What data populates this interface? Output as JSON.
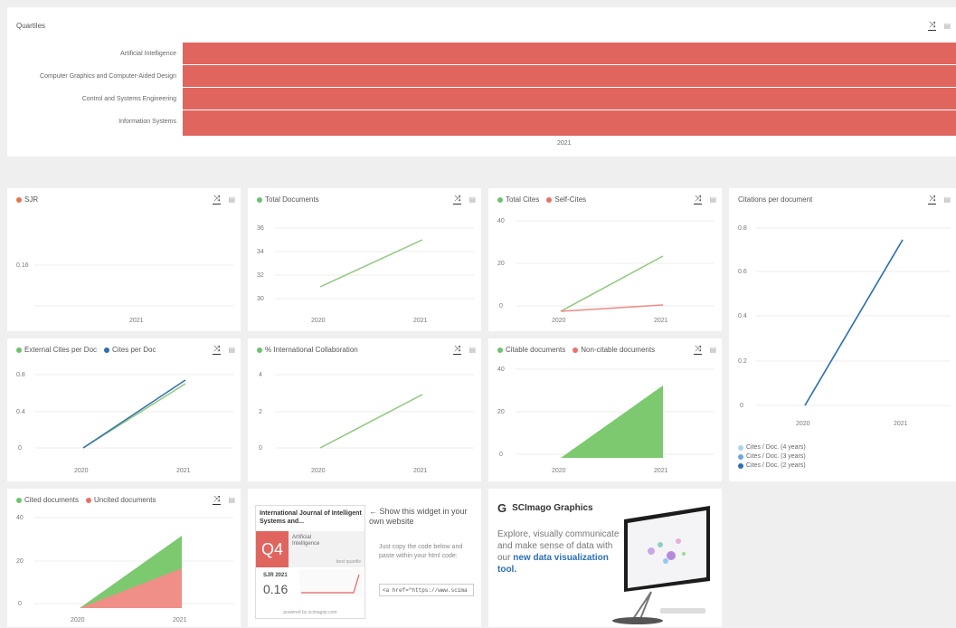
{
  "quartiles": {
    "title": "Quartiles",
    "categories": [
      "Artificial Intelligence",
      "Computer Graphics and Computer-Aided Design",
      "Control and Systems Engineering",
      "Information Systems"
    ],
    "year": "2021",
    "color": "#e0655f"
  },
  "sjr": {
    "legend": [
      "SJR"
    ],
    "yticks": [
      "0.16"
    ],
    "xticks": [
      "2021"
    ]
  },
  "total_docs": {
    "legend": [
      "Total Documents"
    ],
    "yticks": [
      "30",
      "32",
      "34",
      "36"
    ],
    "xticks": [
      "2020",
      "2021"
    ]
  },
  "total_cites": {
    "legend": [
      "Total Cites",
      "Self-Cites"
    ],
    "yticks": [
      "0",
      "20",
      "40"
    ],
    "xticks": [
      "2020",
      "2021"
    ]
  },
  "cites_per_doc": {
    "title": "Citations per document",
    "yticks": [
      "0",
      "0.2",
      "0.4",
      "0.6",
      "0.8"
    ],
    "xticks": [
      "2020",
      "2021"
    ],
    "legend": [
      "Cites / Doc. (4 years)",
      "Cites / Doc. (3 years)",
      "Cites / Doc. (2 years)"
    ]
  },
  "ext_cites": {
    "legend": [
      "External Cites per Doc",
      "Cites per Doc"
    ],
    "yticks": [
      "0",
      "0.4",
      "0.8"
    ],
    "xticks": [
      "2020",
      "2021"
    ]
  },
  "intl_collab": {
    "legend": [
      "% International Collaboration"
    ],
    "yticks": [
      "0",
      "2",
      "4"
    ],
    "xticks": [
      "2020",
      "2021"
    ]
  },
  "citable_docs": {
    "legend": [
      "Citable documents",
      "Non-citable documents"
    ],
    "yticks": [
      "0",
      "20",
      "40"
    ],
    "xticks": [
      "2020",
      "2021"
    ]
  },
  "cited_docs": {
    "legend": [
      "Cited documents",
      "Uncited documents"
    ],
    "yticks": [
      "0",
      "20",
      "40"
    ],
    "xticks": [
      "2020",
      "2021"
    ]
  },
  "widget": {
    "journal_title": "International Journal of Intelligent Systems and...",
    "quartile": "Q4",
    "category": "Artificial Intelligence",
    "best_quartile": "best quartile",
    "sjr_label": "SJR 2021",
    "sjr_value": "0.16",
    "powered": "powered by scimagojr.com",
    "arrow_text": "← Show this widget in your own website",
    "copy_text": "Just copy the code below and paste within your html code:",
    "code": "<a href=\"https://www.scima"
  },
  "graphics": {
    "title": "SCImago Graphics",
    "desc": "Explore, visually communicate and make sense of data with our",
    "link": "new data visualization tool."
  },
  "chart_data": [
    {
      "type": "bar",
      "title": "Quartiles",
      "categories": [
        "Artificial Intelligence",
        "Computer Graphics and Computer-Aided Design",
        "Control and Systems Engineering",
        "Information Systems"
      ],
      "x": [
        "2021"
      ],
      "values": [
        "Q4",
        "Q4",
        "Q4",
        "Q4"
      ]
    },
    {
      "type": "line",
      "x": [
        2021
      ],
      "series": [
        {
          "name": "SJR",
          "values": [
            0.16
          ]
        }
      ]
    },
    {
      "type": "line",
      "x": [
        2020,
        2021
      ],
      "series": [
        {
          "name": "Total Documents",
          "values": [
            31,
            35
          ]
        }
      ]
    },
    {
      "type": "line",
      "x": [
        2020,
        2021
      ],
      "series": [
        {
          "name": "Total Cites",
          "values": [
            0,
            23
          ]
        },
        {
          "name": "Self-Cites",
          "values": [
            0,
            3
          ]
        }
      ]
    },
    {
      "type": "line",
      "title": "Citations per document",
      "x": [
        2020,
        2021
      ],
      "series": [
        {
          "name": "Cites / Doc. (4 years)",
          "values": [
            0,
            0.74
          ]
        },
        {
          "name": "Cites / Doc. (3 years)",
          "values": [
            0,
            0.74
          ]
        },
        {
          "name": "Cites / Doc. (2 years)",
          "values": [
            0,
            0.74
          ]
        }
      ]
    },
    {
      "type": "line",
      "x": [
        2020,
        2021
      ],
      "series": [
        {
          "name": "External Cites per Doc",
          "values": [
            0,
            0.65
          ]
        },
        {
          "name": "Cites per Doc",
          "values": [
            0,
            0.7
          ]
        }
      ]
    },
    {
      "type": "line",
      "x": [
        2020,
        2021
      ],
      "series": [
        {
          "name": "% International Collaboration",
          "values": [
            0,
            2.9
          ]
        }
      ]
    },
    {
      "type": "area",
      "x": [
        2020,
        2021
      ],
      "series": [
        {
          "name": "Citable documents",
          "values": [
            0,
            35
          ]
        },
        {
          "name": "Non-citable documents",
          "values": [
            0,
            0
          ]
        }
      ]
    },
    {
      "type": "area",
      "x": [
        2020,
        2021
      ],
      "series": [
        {
          "name": "Cited documents",
          "values": [
            0,
            15
          ]
        },
        {
          "name": "Uncited documents",
          "values": [
            0,
            18
          ]
        }
      ]
    }
  ]
}
